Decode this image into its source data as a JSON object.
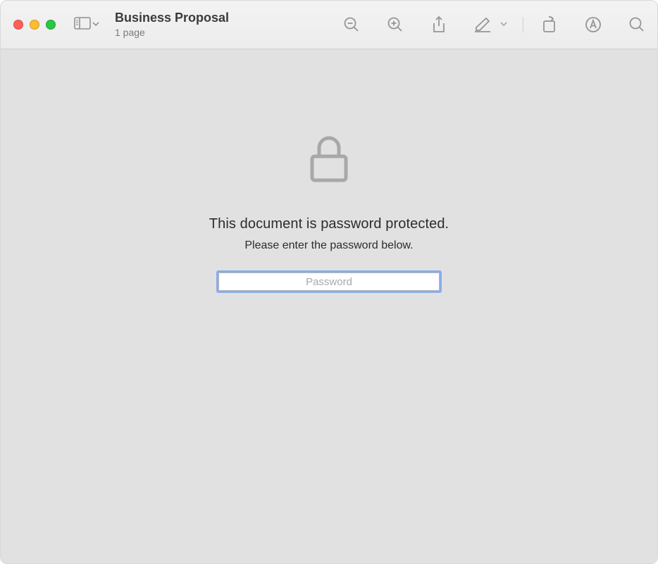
{
  "window": {
    "title": "Business Proposal",
    "subtitle": "1 page"
  },
  "content": {
    "heading": "This document is password protected.",
    "subheading": "Please enter the password below.",
    "password_placeholder": "Password",
    "password_value": ""
  }
}
